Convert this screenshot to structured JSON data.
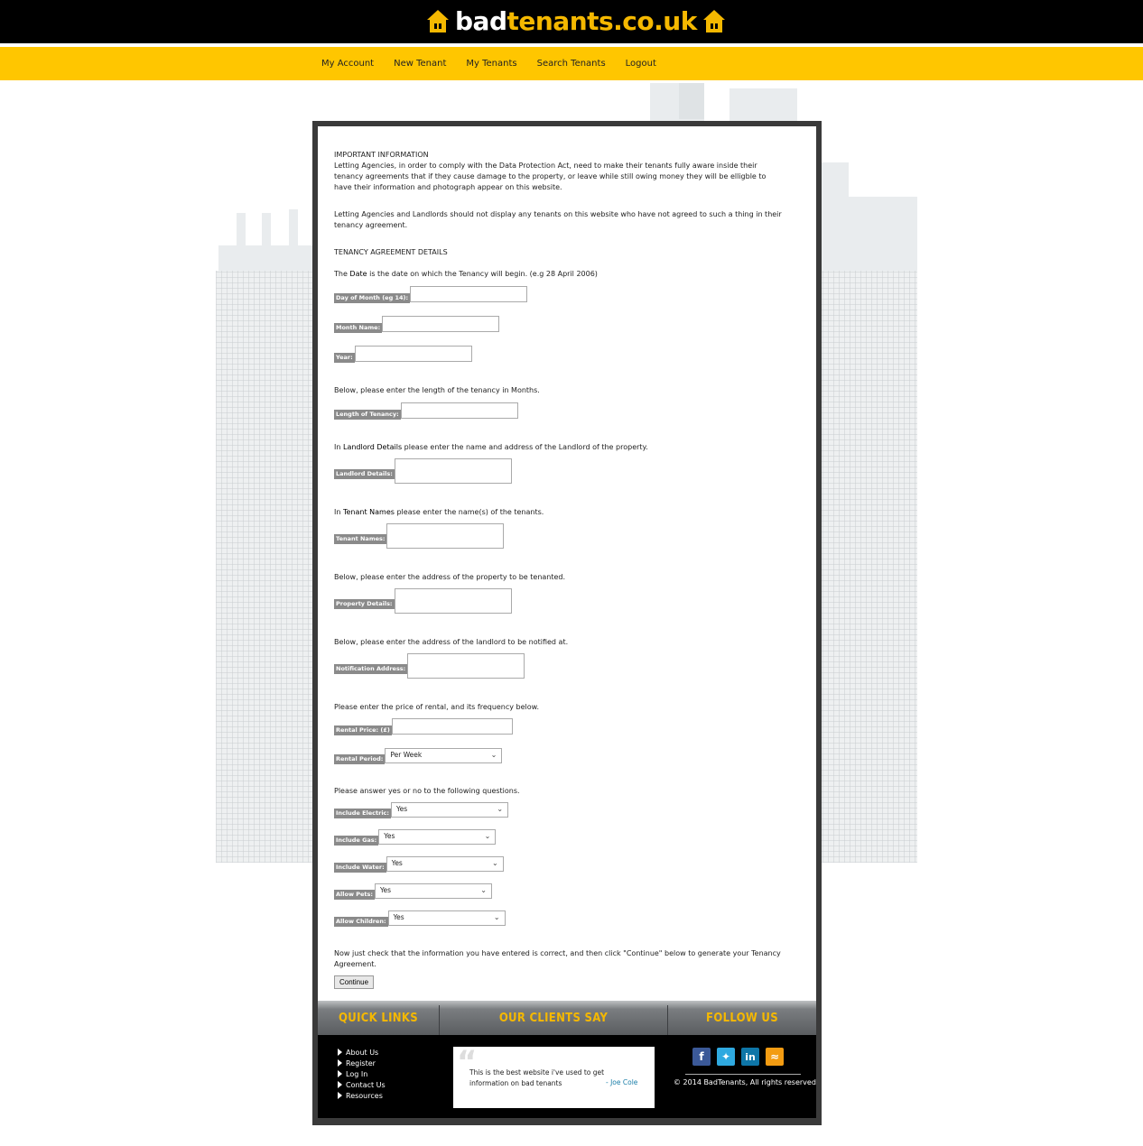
{
  "header": {
    "logo_part1": "bad",
    "logo_part2": "tenants.co.uk",
    "brand_color": "#f5b800"
  },
  "nav": {
    "items": [
      "My Account",
      "New Tenant",
      "My Tenants",
      "Search Tenants",
      "Logout"
    ]
  },
  "info": {
    "heading": "IMPORTANT INFORMATION",
    "p1": "Letting Agencies, in order to comply with the Data Protection Act, need to make their tenants fully aware inside their tenancy agreements that if they cause damage to the property, or leave while still owing money they will be elligble to have their information and photograph appear on this website.",
    "p2": "Letting Agencies and Landlords should not display any tenants on this website who have not agreed to such a thing in their tenancy agreement."
  },
  "form": {
    "heading": "TENANCY AGREEMENT DETAILS",
    "date_intro_pre": "The ",
    "date_intro_bold": "Date",
    "date_intro_post": " is the date on which the Tenancy will begin. (e.g 28 April 2006)",
    "day_label": "Day of Month (eg 14):",
    "month_label": "Month Name:",
    "year_label": "Year:",
    "length_intro": "Below, please enter the length of the tenancy in Months.",
    "length_label": "Length of Tenancy:",
    "landlord_pre": "In ",
    "landlord_bold": "Landlord Details",
    "landlord_post": " please enter the name and address of the Landlord of the property.",
    "landlord_label": "Landlord Details:",
    "tenant_pre": "In ",
    "tenant_bold": "Tenant Names",
    "tenant_post": " please enter the name(s) of the tenants.",
    "tenant_label": "Tenant Names:",
    "property_intro": "Below, please enter the address of the property to be tenanted.",
    "property_label": "Property Details:",
    "notify_intro": "Below, please enter the address of the landlord to be notified at.",
    "notify_label": "Notification Address:",
    "rent_intro": "Please enter the price of rental, and its frequency below.",
    "rent_price_label": "Rental Price: (£)",
    "rent_period_label": "Rental Period:",
    "rent_period_value": "Per Week",
    "yesno_intro": "Please answer yes or no to the following questions.",
    "electric_label": "Include Electric:",
    "gas_label": "Include Gas:",
    "water_label": "Include Water:",
    "pets_label": "Allow Pets:",
    "children_label": "Allow Children:",
    "yes": "Yes",
    "final_text": "Now just check that the information you have entered is correct, and then click \"Continue\" below to generate your Tenancy Agreement.",
    "continue": "Continue"
  },
  "footer": {
    "quick_links_title": "QUICK LINKS",
    "clients_title": "OUR CLIENTS SAY",
    "follow_title": "FOLLOW US",
    "links": [
      "About Us",
      "Register",
      "Log In",
      "Contact Us",
      "Resources"
    ],
    "quote": "This is the best website i've used to get information on bad tenants",
    "quote_author": "- Joe Cole",
    "copyright": "© 2014 BadTenants, All rights reserved"
  }
}
